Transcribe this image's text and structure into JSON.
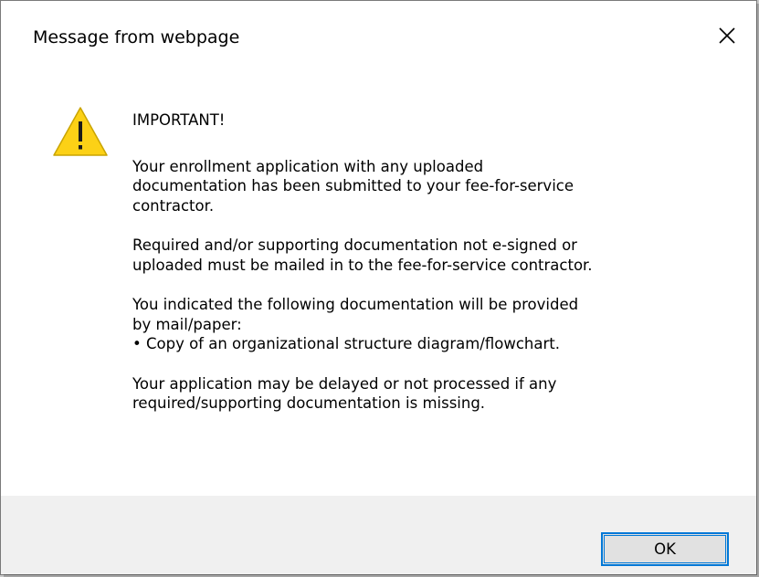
{
  "dialog": {
    "title": "Message from webpage",
    "close_icon": "close-icon",
    "warning_icon": "warning-triangle-icon",
    "heading": "IMPORTANT!",
    "paragraphs": [
      [
        "Your enrollment application with any uploaded",
        "documentation has been submitted to your fee-for-service",
        "contractor."
      ],
      [
        "Required and/or supporting documentation not e-signed or",
        "uploaded must be mailed in to the fee-for-service contractor."
      ],
      [
        "You indicated the following documentation will be provided",
        "by mail/paper:",
        "• Copy of an organizational structure diagram/flowchart."
      ],
      [
        "Your application may be delayed or not processed if any",
        "required/supporting documentation is missing."
      ]
    ],
    "ok_label": "OK"
  },
  "colors": {
    "accent": "#0078d7",
    "warning_fill": "#fcd116",
    "footer_bg": "#f0f0f0"
  }
}
